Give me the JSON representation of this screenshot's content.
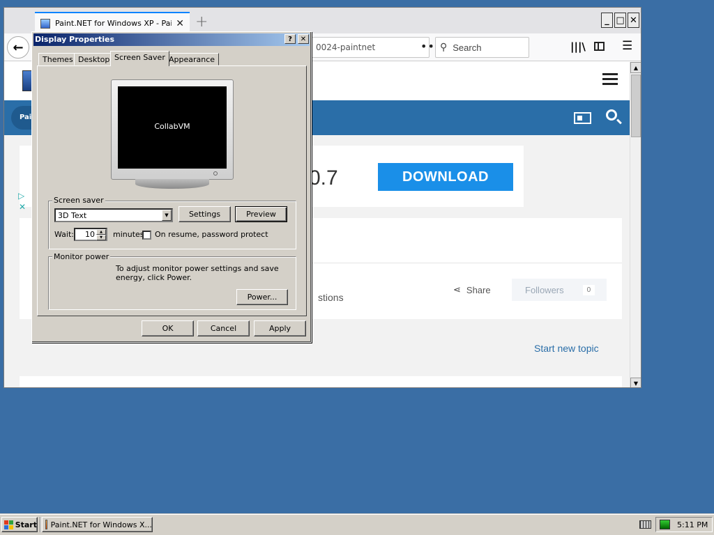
{
  "browser": {
    "tab_title": "Paint.NET for Windows XP - Paint.",
    "tab_close": "✕",
    "new_tab": "+",
    "controls": {
      "minimize": "_",
      "maximize": "□",
      "close": "✕"
    },
    "url_fragment": "0024-paintnet",
    "page_actions": "•••",
    "search_placeholder": "Search"
  },
  "page": {
    "nav_pill": "Pai",
    "ad_version": "0.7",
    "download_label": "DOWNLOAD",
    "questions_text": "stions",
    "share_label": "Share",
    "followers_label": "Followers",
    "followers_count": "0",
    "start_new_topic": "Start new topic"
  },
  "dialog": {
    "title": "Display Properties",
    "help": "?",
    "close": "✕",
    "tabs": [
      "Themes",
      "Desktop",
      "Screen Saver",
      "Appearance"
    ],
    "active_tab": "Screen Saver",
    "preview_text": "CollabVM",
    "screensaver_group": "Screen saver",
    "screensaver_value": "3D Text",
    "settings_label": "Settings",
    "preview_label": "Preview",
    "wait_label": "Wait:",
    "wait_value": "10",
    "minutes_label": "minutes",
    "password_label": "On resume, password protect",
    "password_checked": false,
    "monitor_group": "Monitor power",
    "monitor_desc": "To adjust monitor power settings and save energy, click Power.",
    "power_label": "Power...",
    "ok_label": "OK",
    "cancel_label": "Cancel",
    "apply_label": "Apply"
  },
  "taskbar": {
    "start_label": "Start",
    "task_label": "Paint.NET for Windows X...",
    "clock": "5:11 PM"
  },
  "colors": {
    "desktop": "#3a6ea5",
    "site_nav": "#2a6ea8",
    "download": "#1a8fe8",
    "titlebar_start": "#0a246a",
    "titlebar_end": "#a6caf0"
  }
}
